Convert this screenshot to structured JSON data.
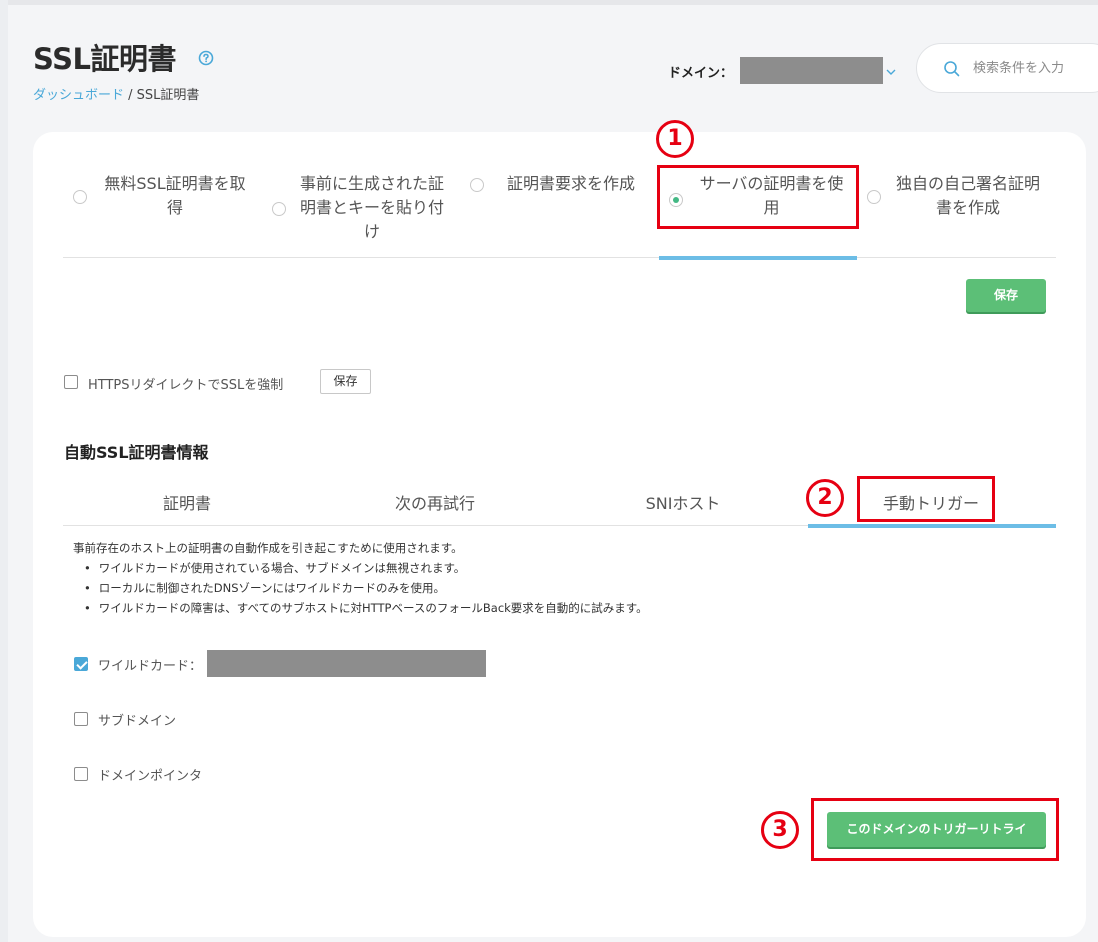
{
  "header": {
    "title": "SSL証明書",
    "help_icon": "question-circle-icon",
    "breadcrumb": {
      "home": "ダッシュボード",
      "separator": " / ",
      "current": "SSL証明書"
    },
    "domain_label": "ドメイン：",
    "search_placeholder": "検索条件を入力"
  },
  "options": [
    {
      "lines": [
        "無料SSL証明書を取",
        "得"
      ],
      "selected": false
    },
    {
      "lines": [
        "事前に生成された証",
        "明書とキーを貼り付",
        "け"
      ],
      "selected": false
    },
    {
      "lines": [
        "証明書要求を作成"
      ],
      "selected": false
    },
    {
      "lines": [
        "サーバの証明書を使",
        "用"
      ],
      "selected": true
    },
    {
      "lines": [
        "独自の自己署名証明",
        "書を作成"
      ],
      "selected": false
    }
  ],
  "save_button": "保存",
  "https_redirect": {
    "label": "HTTPSリダイレクトでSSLを強制",
    "checked": false,
    "save_label": "保存"
  },
  "auto_ssl": {
    "title": "自動SSL証明書情報",
    "tabs": [
      "証明書",
      "次の再試行",
      "SNIホスト",
      "手動トリガー"
    ],
    "active_tab": 3,
    "description": "事前存在のホスト上の証明書の自動作成を引き起こすために使用されます。",
    "bullets": [
      "ワイルドカードが使用されている場合、サブドメインは無視されます。",
      "ローカルに制御されたDNSゾーンにはワイルドカードのみを使用。",
      "ワイルドカードの障害は、すべてのサブホストに対HTTPベースのフォールBack要求を自動的に試みます。"
    ],
    "wildcard": {
      "label": "ワイルドカード：",
      "checked": true
    },
    "subdomain": {
      "label": "サブドメイン",
      "checked": false
    },
    "domain_pointer": {
      "label": "ドメインポインタ",
      "checked": false
    },
    "retry_button": "このドメインのトリガーリトライ"
  },
  "annotations": {
    "one": "1",
    "two": "2",
    "three": "3",
    "color": "#e60012"
  },
  "colors": {
    "accent": "#6cbde6",
    "green": "#5cbf77",
    "link": "#4aa8d8"
  }
}
